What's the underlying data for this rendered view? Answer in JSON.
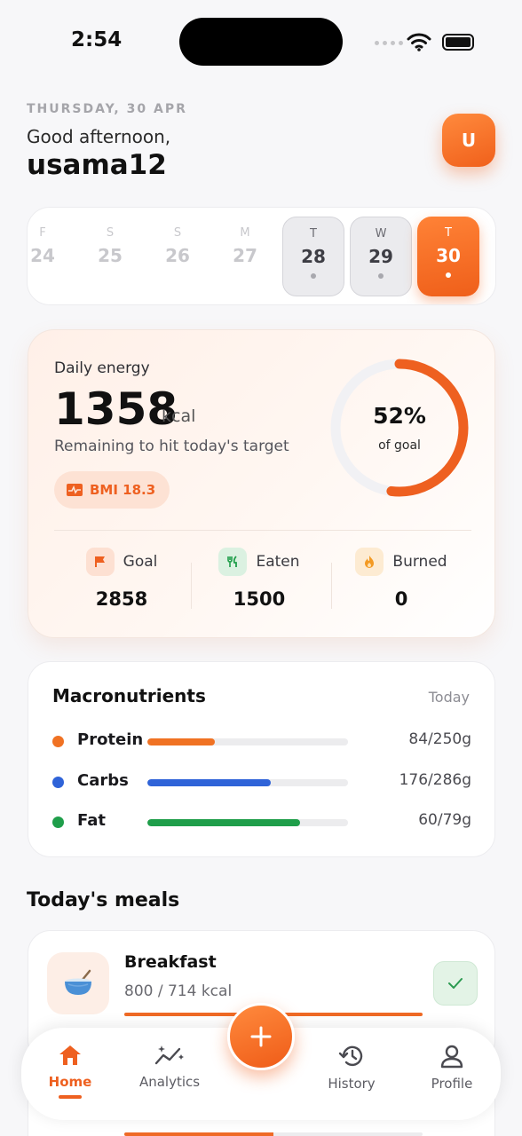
{
  "status": {
    "time": "2:54"
  },
  "header": {
    "date": "THURSDAY, 30 APR",
    "greeting": "Good afternoon,",
    "username": "usama12",
    "avatar_initial": "U"
  },
  "week": [
    {
      "letter": "F",
      "num": "24",
      "state": "future"
    },
    {
      "letter": "S",
      "num": "25",
      "state": "future"
    },
    {
      "letter": "S",
      "num": "26",
      "state": "future"
    },
    {
      "letter": "M",
      "num": "27",
      "state": "future"
    },
    {
      "letter": "T",
      "num": "28",
      "state": "past"
    },
    {
      "letter": "W",
      "num": "29",
      "state": "past"
    },
    {
      "letter": "T",
      "num": "30",
      "state": "selected"
    }
  ],
  "energy": {
    "label": "Daily energy",
    "value": "1358",
    "unit": "kcal",
    "sub": "Remaining to hit today's target",
    "bmi": "BMI 18.3",
    "ring_percent_text": "52%",
    "ring_fraction": 0.52,
    "ring_sub": "of goal",
    "stats": [
      {
        "label": "Goal",
        "value": "2858",
        "icon": "flag-icon"
      },
      {
        "label": "Eaten",
        "value": "1500",
        "icon": "fork-knife-icon"
      },
      {
        "label": "Burned",
        "value": "0",
        "icon": "flame-icon"
      }
    ]
  },
  "macros": {
    "title": "Macronutrients",
    "period": "Today",
    "items": [
      {
        "name": "Protein",
        "amount": "84/250g",
        "fraction": 0.336,
        "color": "#f07223"
      },
      {
        "name": "Carbs",
        "amount": "176/286g",
        "fraction": 0.615,
        "color": "#2f63d8"
      },
      {
        "name": "Fat",
        "amount": "60/79g",
        "fraction": 0.759,
        "color": "#1f9e4a"
      }
    ]
  },
  "meals": {
    "title": "Today's meals",
    "items": [
      {
        "name": "Breakfast",
        "kcal": "800 / 714 kcal",
        "fraction": 1.0,
        "done": true,
        "icon": "bowl-icon"
      }
    ],
    "next_fraction": 0.5
  },
  "nav": {
    "tabs": [
      {
        "label": "Home",
        "icon": "home-icon",
        "active": true
      },
      {
        "label": "Analytics",
        "icon": "analytics-icon",
        "active": false
      },
      {
        "label": "History",
        "icon": "history-icon",
        "active": false
      },
      {
        "label": "Profile",
        "icon": "profile-icon",
        "active": false
      }
    ],
    "fab_icon": "plus-icon"
  },
  "colors": {
    "accent": "#ee6020"
  }
}
